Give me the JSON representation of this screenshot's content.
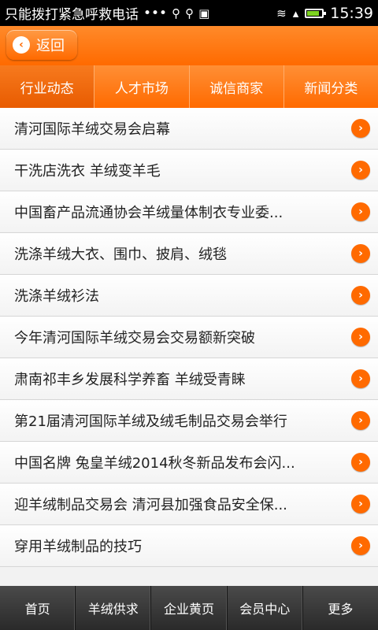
{
  "status_bar": {
    "notification_text": "只能拨打紧急呼救电话",
    "dots": "•••",
    "icons": [
      "usb-icon",
      "usb-icon",
      "image-icon",
      "wifi-icon",
      "signal-icon",
      "battery-icon"
    ],
    "time": "15:39",
    "battery_level": 0.85
  },
  "header": {
    "back_label": "返回",
    "accent_color": "#ff6a00"
  },
  "tabs": [
    {
      "label": "行业动态",
      "active": true
    },
    {
      "label": "人才市场",
      "active": false
    },
    {
      "label": "诚信商家",
      "active": false
    },
    {
      "label": "新闻分类",
      "active": false
    }
  ],
  "list": [
    {
      "title": "清河国际羊绒交易会启幕"
    },
    {
      "title": "干洗店洗衣 羊绒变羊毛"
    },
    {
      "title": "中国畜产品流通协会羊绒量体制衣专业委..."
    },
    {
      "title": "洗涤羊绒大衣、围巾、披肩、绒毯"
    },
    {
      "title": "洗涤羊绒衫法"
    },
    {
      "title": "今年清河国际羊绒交易会交易额新突破"
    },
    {
      "title": "肃南祁丰乡发展科学养畜 羊绒受青睐"
    },
    {
      "title": "第21届清河国际羊绒及绒毛制品交易会举行"
    },
    {
      "title": "中国名牌 兔皇羊绒2014秋冬新品发布会闪..."
    },
    {
      "title": "迎羊绒制品交易会 清河县加强食品安全保..."
    },
    {
      "title": "穿用羊绒制品的技巧"
    }
  ],
  "bottom_nav": [
    {
      "label": "首页"
    },
    {
      "label": "羊绒供求"
    },
    {
      "label": "企业黄页"
    },
    {
      "label": "会员中心"
    },
    {
      "label": "更多"
    }
  ]
}
